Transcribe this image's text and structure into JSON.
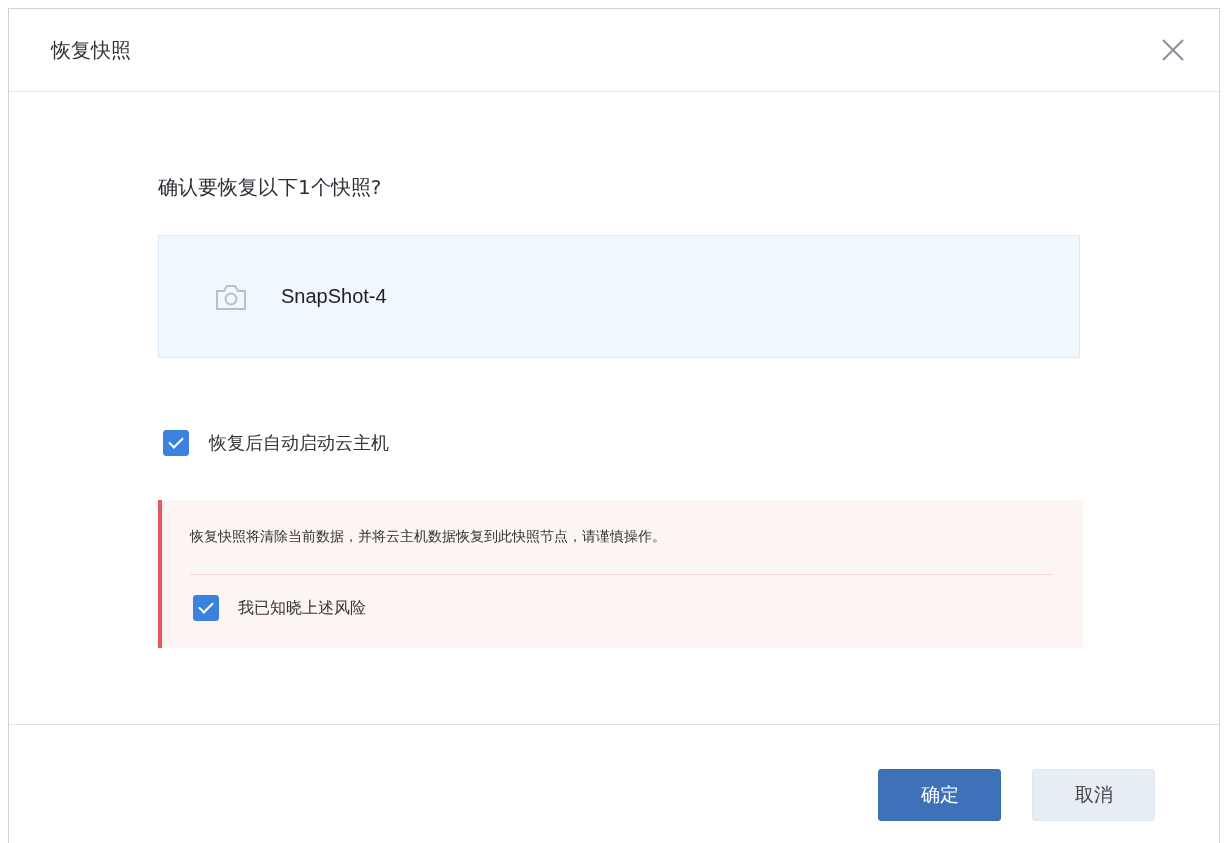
{
  "dialog": {
    "title": "恢复快照",
    "question": "确认要恢复以下1个快照?",
    "snapshots": [
      {
        "name": "SnapShot-4"
      }
    ],
    "auto_start": {
      "label": "恢复后自动启动云主机",
      "checked": true
    },
    "warning": {
      "message": "恢复快照将清除当前数据，并将云主机数据恢复到此快照节点，请谨慎操作。",
      "acknowledge": {
        "label": "我已知晓上述风险",
        "checked": true
      }
    },
    "buttons": [
      {
        "label": "确定",
        "kind": "primary"
      },
      {
        "label": "取消",
        "kind": "secondary"
      }
    ]
  }
}
